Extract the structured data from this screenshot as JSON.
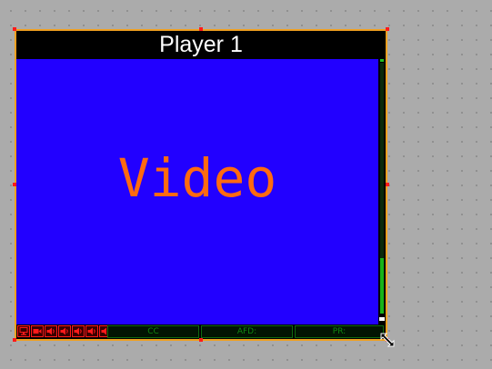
{
  "player": {
    "title": "Player 1",
    "video_label": "Video",
    "audio_level": 0.22,
    "status": {
      "icons": [
        "monitor-icon",
        "camera-icon",
        "speaker-icon",
        "speaker-icon",
        "speaker-icon",
        "speaker-icon",
        "speaker-icon"
      ],
      "cc_label": "CC",
      "afd_label": "AFD:",
      "pr_label": "PR:"
    }
  },
  "colors": {
    "canvas": "#ababab",
    "border": "#f0a020",
    "video_bg": "#2200ff",
    "video_text": "#ff6a10",
    "alert_red": "#ff1a1a",
    "status_green": "#118a11",
    "meter_green": "#18b418"
  }
}
